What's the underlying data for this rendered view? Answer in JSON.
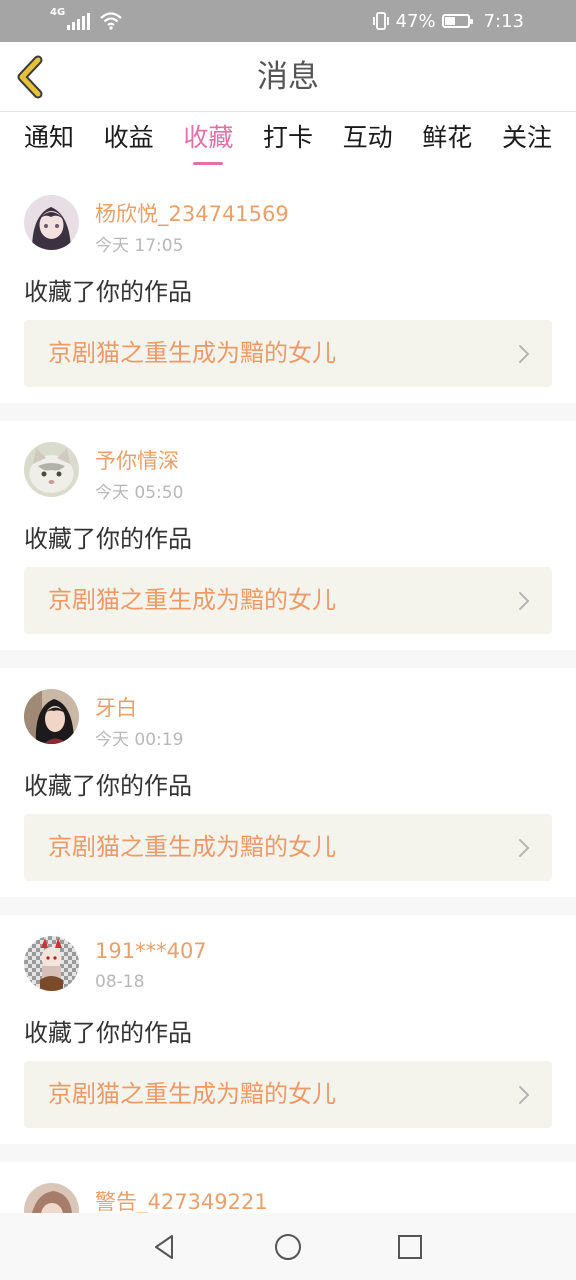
{
  "status_bar": {
    "network": "4G",
    "battery_percent": "47%",
    "battery_level": 0.47,
    "time": "7:13",
    "icons": [
      "signal-icon",
      "wifi-icon",
      "vibrate-icon",
      "battery-icon"
    ]
  },
  "header": {
    "title": "消息",
    "back_icon": "back-chevron-icon"
  },
  "tabs": [
    {
      "label": "通知",
      "active": false
    },
    {
      "label": "收益",
      "active": false
    },
    {
      "label": "收藏",
      "active": true
    },
    {
      "label": "打卡",
      "active": false
    },
    {
      "label": "互动",
      "active": false
    },
    {
      "label": "鲜花",
      "active": false
    },
    {
      "label": "关注",
      "active": false
    }
  ],
  "feed": [
    {
      "username": "杨欣悦_234741569",
      "time": "今天 17:05",
      "action": "收藏了你的作品",
      "work_title": "京剧猫之重生成为黯的女儿"
    },
    {
      "username": "予你情深",
      "time": "今天 05:50",
      "action": "收藏了你的作品",
      "work_title": "京剧猫之重生成为黯的女儿"
    },
    {
      "username": "牙白",
      "time": "今天 00:19",
      "action": "收藏了你的作品",
      "work_title": "京剧猫之重生成为黯的女儿"
    },
    {
      "username": "191***407",
      "time": "08-18",
      "action": "收藏了你的作品",
      "work_title": "京剧猫之重生成为黯的女儿"
    },
    {
      "username": "警告_427349221",
      "time": "",
      "action": "",
      "work_title": ""
    }
  ],
  "nav_bar": {
    "icons": [
      "back-triangle-icon",
      "home-circle-icon",
      "recents-square-icon"
    ]
  },
  "colors": {
    "accent": "#e271a7",
    "username": "#e8a06d",
    "work_title": "#ec9a67",
    "work_bg": "#f5f4ec",
    "back_icon": "#e6c23a"
  }
}
